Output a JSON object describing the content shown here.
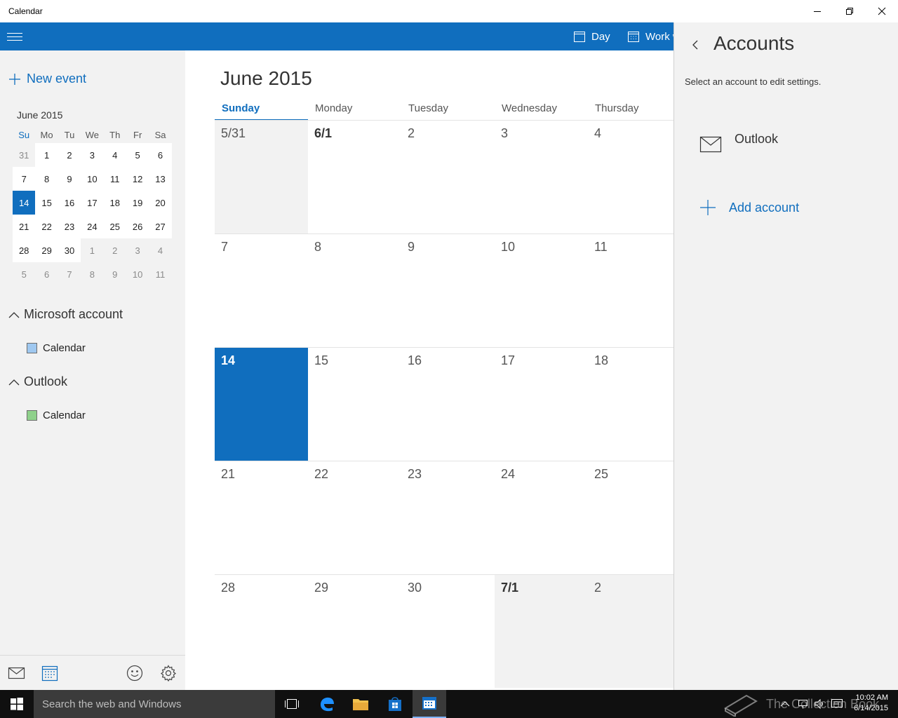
{
  "window": {
    "title": "Calendar"
  },
  "commandbar": {
    "day_label": "Day",
    "workweek_label": "Work w"
  },
  "sidebar": {
    "new_event_label": "New event",
    "mini_calendar": {
      "title": "June 2015",
      "weekday_headers": [
        "Su",
        "Mo",
        "Tu",
        "We",
        "Th",
        "Fr",
        "Sa"
      ],
      "weeks": [
        [
          "31",
          "1",
          "2",
          "3",
          "4",
          "5",
          "6"
        ],
        [
          "7",
          "8",
          "9",
          "10",
          "11",
          "12",
          "13"
        ],
        [
          "14",
          "15",
          "16",
          "17",
          "18",
          "19",
          "20"
        ],
        [
          "21",
          "22",
          "23",
          "24",
          "25",
          "26",
          "27"
        ],
        [
          "28",
          "29",
          "30",
          "1",
          "2",
          "3",
          "4"
        ],
        [
          "5",
          "6",
          "7",
          "8",
          "9",
          "10",
          "11"
        ]
      ]
    },
    "groups": [
      {
        "name": "Microsoft account",
        "calendar": "Calendar",
        "color": "#9fc8f0"
      },
      {
        "name": "Outlook",
        "calendar": "Calendar",
        "color": "#8fd18b"
      }
    ]
  },
  "main": {
    "month_title": "June 2015",
    "weekdays": [
      "Sunday",
      "Monday",
      "Tuesday",
      "Wednesday",
      "Thursday"
    ],
    "weeks": [
      [
        "5/31",
        "6/1",
        "2",
        "3",
        "4"
      ],
      [
        "7",
        "8",
        "9",
        "10",
        "11"
      ],
      [
        "14",
        "15",
        "16",
        "17",
        "18"
      ],
      [
        "21",
        "22",
        "23",
        "24",
        "25"
      ],
      [
        "28",
        "29",
        "30",
        "7/1",
        "2"
      ]
    ]
  },
  "accounts_panel": {
    "title": "Accounts",
    "subtitle": "Select an account to edit settings.",
    "account_name": "Outlook",
    "add_account_label": "Add account"
  },
  "taskbar": {
    "search_placeholder": "Search the web and Windows",
    "clock_time": "10:02 AM",
    "clock_date": "6/14/2015"
  },
  "watermark": {
    "text": "The Collection Book"
  },
  "colors": {
    "accent": "#106ebe",
    "pane_bg": "#f2f2f2",
    "taskbar_bg": "#101010"
  }
}
